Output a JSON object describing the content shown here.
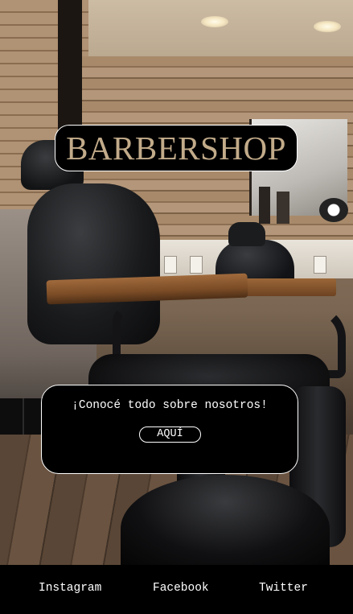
{
  "header": {
    "title": "BARBERSHOP"
  },
  "card": {
    "text": "¡Conocé todo sobre nosotros!",
    "button_label": "AQUÍ"
  },
  "footer": {
    "links": [
      {
        "label": "Instagram"
      },
      {
        "label": "Facebook"
      },
      {
        "label": "Twitter"
      }
    ]
  },
  "colors": {
    "title": "#c2ab8a",
    "background": "#000000",
    "border": "#ffffff"
  }
}
